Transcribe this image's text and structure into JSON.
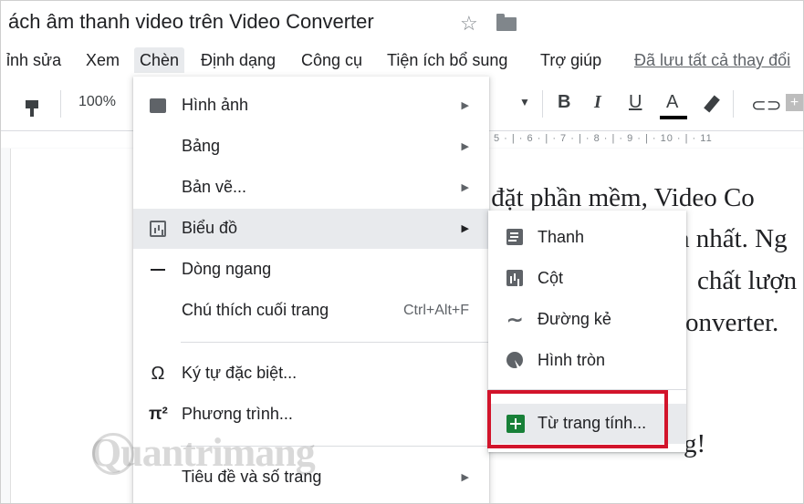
{
  "document": {
    "title": "ách âm thanh video trên Video Converter",
    "body_lines": [
      "i đặt phần mềm, Video Co",
      "h nhất. Ng",
      "chất lượn",
      "onverter.",
      "g!"
    ]
  },
  "menubar": {
    "items": [
      "ỉnh sửa",
      "Xem",
      "Chèn",
      "Định dạng",
      "Công cụ",
      "Tiện ích bổ sung",
      "Trợ giúp"
    ],
    "saved_status": "Đã lưu tất cả thay đổi"
  },
  "toolbar": {
    "zoom": "100%",
    "bold": "B",
    "italic": "I",
    "underline": "U",
    "text_color": "A",
    "text_color_value": "#000000"
  },
  "ruler": {
    "text": "5 · | · 6 · | · 7 · | · 8 · | · 9 · | · 10 · | · 11"
  },
  "insert_menu": {
    "items": [
      {
        "label": "Hình ảnh",
        "icon": "image-icon"
      },
      {
        "label": "Bảng"
      },
      {
        "label": "Bản vẽ..."
      },
      {
        "label": "Biểu đồ",
        "icon": "chart-icon",
        "highlighted": true
      },
      {
        "label": "Dòng ngang",
        "icon": "horizontal-line-icon"
      },
      {
        "label": "Chú thích cuối trang",
        "shortcut": "Ctrl+Alt+F"
      },
      {
        "label": "Ký tự đặc biệt...",
        "icon": "omega-icon",
        "icon_glyph": "Ω"
      },
      {
        "label": "Phương trình...",
        "icon": "pi-icon",
        "icon_glyph": "π²"
      },
      {
        "label": "Tiêu đề và số trang"
      }
    ]
  },
  "chart_submenu": {
    "items": [
      {
        "label": "Thanh",
        "icon": "bar-chart-icon"
      },
      {
        "label": "Cột",
        "icon": "column-chart-icon"
      },
      {
        "label": "Đường kẻ",
        "icon": "line-chart-icon",
        "icon_glyph": "∼"
      },
      {
        "label": "Hình tròn",
        "icon": "pie-chart-icon"
      },
      {
        "label": "Từ trang tính...",
        "icon": "sheets-icon",
        "highlighted": true
      }
    ]
  },
  "colors": {
    "highlight_box": "#d2142b",
    "sheets_green": "#188038",
    "menu_hover": "#e8eaed"
  },
  "watermark": "Quantrimang"
}
